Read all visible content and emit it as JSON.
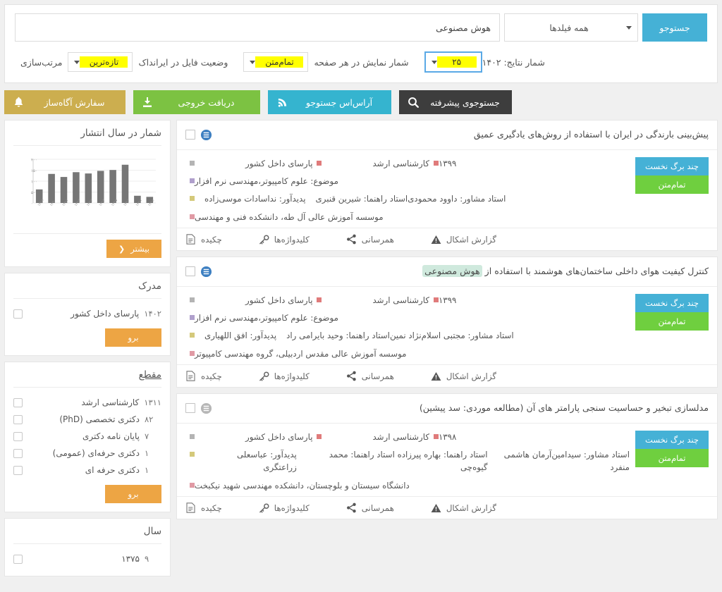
{
  "search": {
    "query_value": "هوش مصنوعی",
    "query_placeholder": "",
    "field_select_value": "همه فیلدها",
    "search_button": "جستوجو"
  },
  "options": {
    "sort_label": "مرتب‌سازی",
    "sort_value": "تازه‌ترین",
    "file_status_label": "وضعیت فایل در ایرانداک",
    "file_status_value": "تمام‌متن",
    "per_page_label": "شمار نمایش در هر صفحه",
    "per_page_value": "۲۵",
    "results_count_label": "شمار نتایج: ۱۴۰۲"
  },
  "toolbar": {
    "alert_label": "سفارش آگاه‌ساز",
    "export_label": "دریافت خروجی",
    "rss_label": "آر‌اس‌اس جستوجو",
    "advanced_label": "جستوجوی پیشرفته"
  },
  "card_footer": {
    "abstract": "چکیده",
    "keywords": "کلیدواژه‌ها",
    "share": "همرسانی",
    "report": "گزارش اشکال"
  },
  "badges": {
    "first_pages": "چند برگ نخست",
    "full_text": "تمام‌متن"
  },
  "results": [
    {
      "title_before": "پیش‌بینی بارندگی در ایران با استفاده از روش‌های یادگیری عمیق",
      "title_highlight": "",
      "title_after": "",
      "icon_state": "active",
      "doc_type": "پارسای داخل کشور",
      "degree": "کارشناسی ارشد",
      "year": "۱۳۹۹",
      "subject": "موضوع: علوم کامپیوتر،مهندسی نرم افزار",
      "author": "پدیدآور: نداسادات موسی‌زاده",
      "supervisor": "استاد راهنما: شیرین قنبری",
      "advisor": "استاد مشاور: داوود محمودی",
      "institution": "موسسه آموزش عالی آل طه، دانشکده فنی و مهندسی"
    },
    {
      "title_before": "کنترل کیفیت هوای داخلی ساختمان‌های هوشمند با استفاده از ",
      "title_highlight": "هوش مصنوعی",
      "title_after": "",
      "icon_state": "active",
      "doc_type": "پارسای داخل کشور",
      "degree": "کارشناسی ارشد",
      "year": "۱۳۹۹",
      "subject": "موضوع: علوم کامپیوتر،مهندسی نرم افزار",
      "author": "پدیدآور: افق اللهیاری",
      "supervisor": "استاد راهنما: وحید بایرامی راد",
      "advisor": "استاد مشاور: مجتبی اسلام‌نژاد نمین",
      "institution": "موسسه آموزش عالی مقدس اردبیلی، گروه مهندسی کامپیوتر"
    },
    {
      "title_before": "مدلسازی تبخیر و حساسیت سنجی پارامتر های آن (مطالعه موردی: سد پیشین)",
      "title_highlight": "",
      "title_after": "",
      "icon_state": "muted",
      "doc_type": "پارسای داخل کشور",
      "degree": "کارشناسی ارشد",
      "year": "۱۳۹۸",
      "subject": "",
      "author": "پدیدآور: عباسعلی زراعتگری",
      "supervisor": "استاد راهنما: بهاره پیرزاده   استاد راهنما: محمد گیوه‌چی",
      "advisor": "استاد مشاور: سیدامین‌آرمان هاشمی منفرد",
      "institution": "دانشگاه سیستان و بلوچستان، دانشکده مهندسی شهید نیکبخت"
    }
  ],
  "sidebar": {
    "chart_panel": {
      "title": "شمار در سال انتشار",
      "more_label": "بیشتر"
    },
    "document_panel": {
      "title": "مدرک",
      "go_label": "برو",
      "items": [
        {
          "label": "پارسای داخل کشور",
          "count": "۱۴۰۲"
        }
      ]
    },
    "level_panel": {
      "title": "مقطع",
      "go_label": "برو",
      "items": [
        {
          "label": "کارشناسی ارشد",
          "count": "۱۳۱۱"
        },
        {
          "label": "دکتری تخصصی (PhD)",
          "count": "۸۲"
        },
        {
          "label": "پایان نامه دکتری",
          "count": "۷"
        },
        {
          "label": "دکتری حرفه‌ای (عمومی)",
          "count": "۱"
        },
        {
          "label": "دکتری حرفه ای",
          "count": "۱"
        }
      ]
    },
    "year_panel": {
      "title": "سال",
      "items": [
        {
          "label": "۱۳۷۵",
          "count": "۹"
        }
      ]
    }
  },
  "chart_data": {
    "type": "bar",
    "title": "شمار در سال انتشار",
    "xlabel": "",
    "ylabel": "",
    "categories": [
      "۱۳۸۹",
      "۱۳۹۰",
      "۱۳۹۱",
      "۱۳۹۲",
      "۱۳۹۳",
      "۱۳۹۴",
      "۱۳۹۵",
      "۱۳۹۶",
      "۱۳۹۷",
      "۱۳۹۸"
    ],
    "values": [
      62,
      133,
      119,
      141,
      135,
      147,
      151,
      175,
      33,
      28
    ],
    "ylim": [
      0,
      200
    ],
    "yticks": [
      "۰",
      "۵۰",
      "۱۰۰",
      "۱۵۰",
      "۲۰۰"
    ],
    "ytick_values": [
      0,
      50,
      100,
      150,
      200
    ],
    "grid": true,
    "bar_color": "#767676",
    "legend": false
  },
  "colors": {
    "accent_cyan": "#45b1d6",
    "accent_green": "#7cc242",
    "accent_gold": "#ccae4f",
    "accent_orange": "#eda544",
    "highlight_yellow": "#ffff00",
    "term_highlight": "#cfe9dd"
  }
}
